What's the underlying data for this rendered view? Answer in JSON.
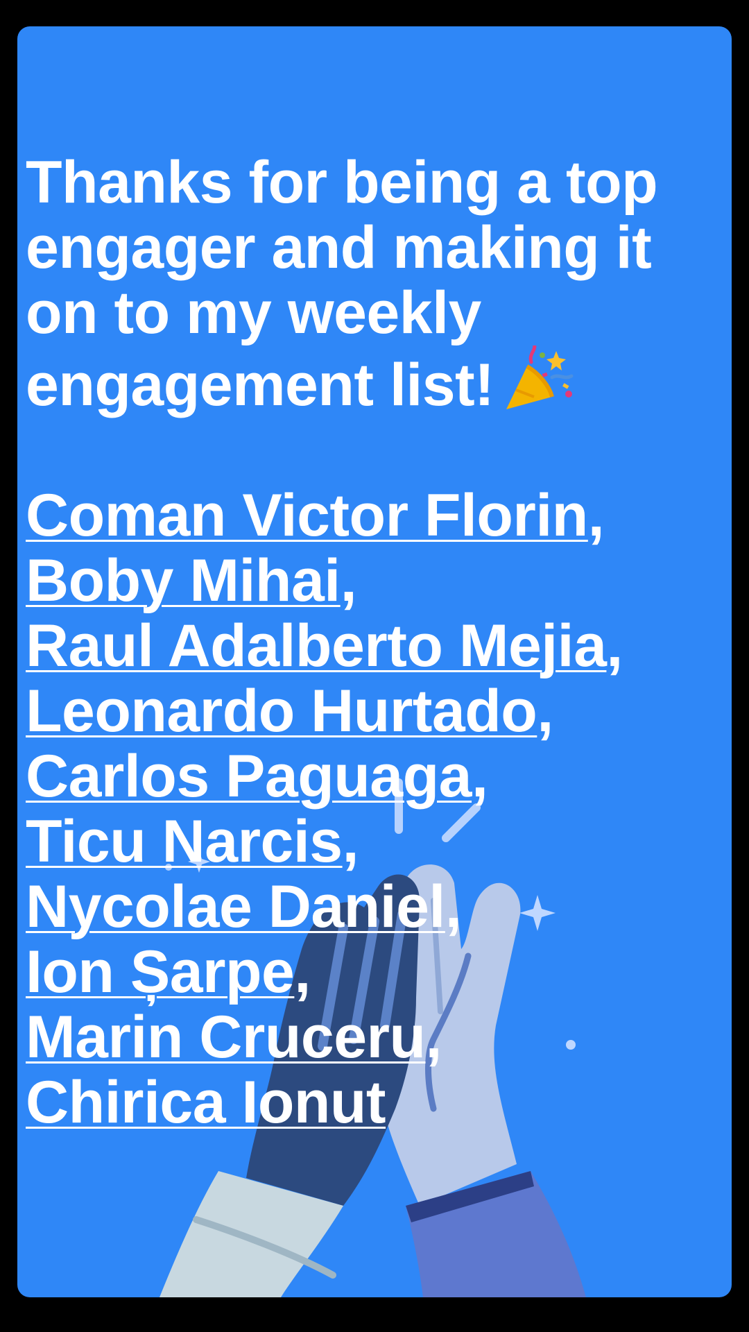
{
  "post": {
    "headline": "Thanks for being a top engager and making it on to my weekly engagement list!",
    "emoji_icon": "party-popper-icon",
    "background_color": "#2f87f7",
    "text_color": "#ffffff",
    "separator": ","
  },
  "names": [
    "Coman Victor Florin",
    "Boby Mihai",
    "Raul Adalberto Mejia",
    "Leonardo Hurtado",
    "Carlos Paguaga",
    "Ticu Narcis",
    "Nycolae Daniel",
    "Ion Șarpe",
    "Marin Cruceru",
    "Chirica Ionut"
  ],
  "illustration": {
    "icon": "high-five-icon",
    "colors": {
      "dark_hand": "#2c4a7f",
      "light_hand": "#b8c9ea",
      "left_sleeve": "#c8d8e0",
      "right_sleeve": "#5e78cf",
      "sparkle": "#cfe0ff"
    }
  }
}
